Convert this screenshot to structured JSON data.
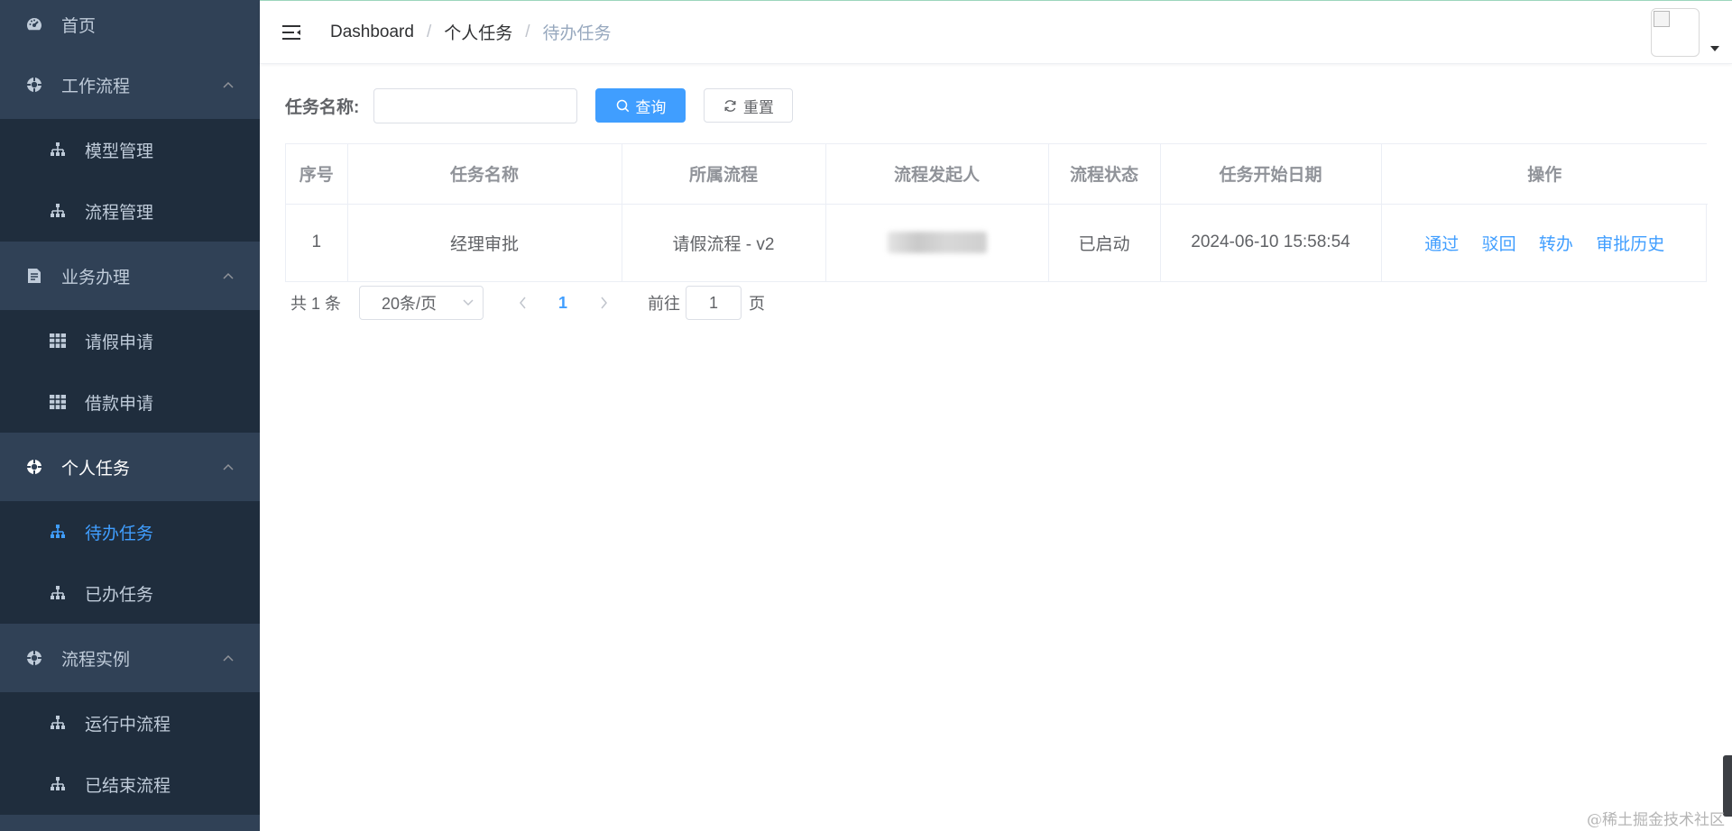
{
  "sidebar": {
    "home": {
      "label": "首页",
      "icon": "dashboard-icon"
    },
    "groups": [
      {
        "title": "工作流程",
        "icon": "workflow-icon",
        "items": [
          {
            "label": "模型管理",
            "icon": "tree-icon"
          },
          {
            "label": "流程管理",
            "icon": "tree-icon"
          }
        ]
      },
      {
        "title": "业务办理",
        "icon": "form-icon",
        "items": [
          {
            "label": "请假申请",
            "icon": "table-icon"
          },
          {
            "label": "借款申请",
            "icon": "table-icon"
          }
        ]
      },
      {
        "title": "个人任务",
        "icon": "workflow-icon",
        "items": [
          {
            "label": "待办任务",
            "icon": "tree-icon",
            "active": true
          },
          {
            "label": "已办任务",
            "icon": "tree-icon"
          }
        ]
      },
      {
        "title": "流程实例",
        "icon": "workflow-icon",
        "items": [
          {
            "label": "运行中流程",
            "icon": "tree-icon"
          },
          {
            "label": "已结束流程",
            "icon": "tree-icon"
          }
        ]
      }
    ]
  },
  "navbar": {
    "breadcrumb": [
      "Dashboard",
      "个人任务",
      "待办任务"
    ],
    "separator": "/"
  },
  "search": {
    "label": "任务名称:",
    "input_value": "",
    "query_label": "查询",
    "reset_label": "重置"
  },
  "table": {
    "columns": [
      "序号",
      "任务名称",
      "所属流程",
      "流程发起人",
      "流程状态",
      "任务开始日期",
      "操作"
    ],
    "rows": [
      {
        "index": "1",
        "task_name": "经理审批",
        "process": "请假流程 - v2",
        "initiator": "",
        "status": "已启动",
        "start_date": "2024-06-10 15:58:54",
        "actions": [
          "通过",
          "驳回",
          "转办",
          "审批历史"
        ]
      }
    ]
  },
  "pagination": {
    "total": "共 1 条",
    "page_size": "20条/页",
    "current_page": "1",
    "goto_label": "前往",
    "goto_value": "1",
    "goto_suffix": "页"
  },
  "watermark": "@稀土掘金技术社区",
  "colors": {
    "sidebar_bg": "#304156",
    "submenu_bg": "#1f2d3d",
    "accent": "#409eff",
    "sidebar_text": "#bfcbd9"
  }
}
